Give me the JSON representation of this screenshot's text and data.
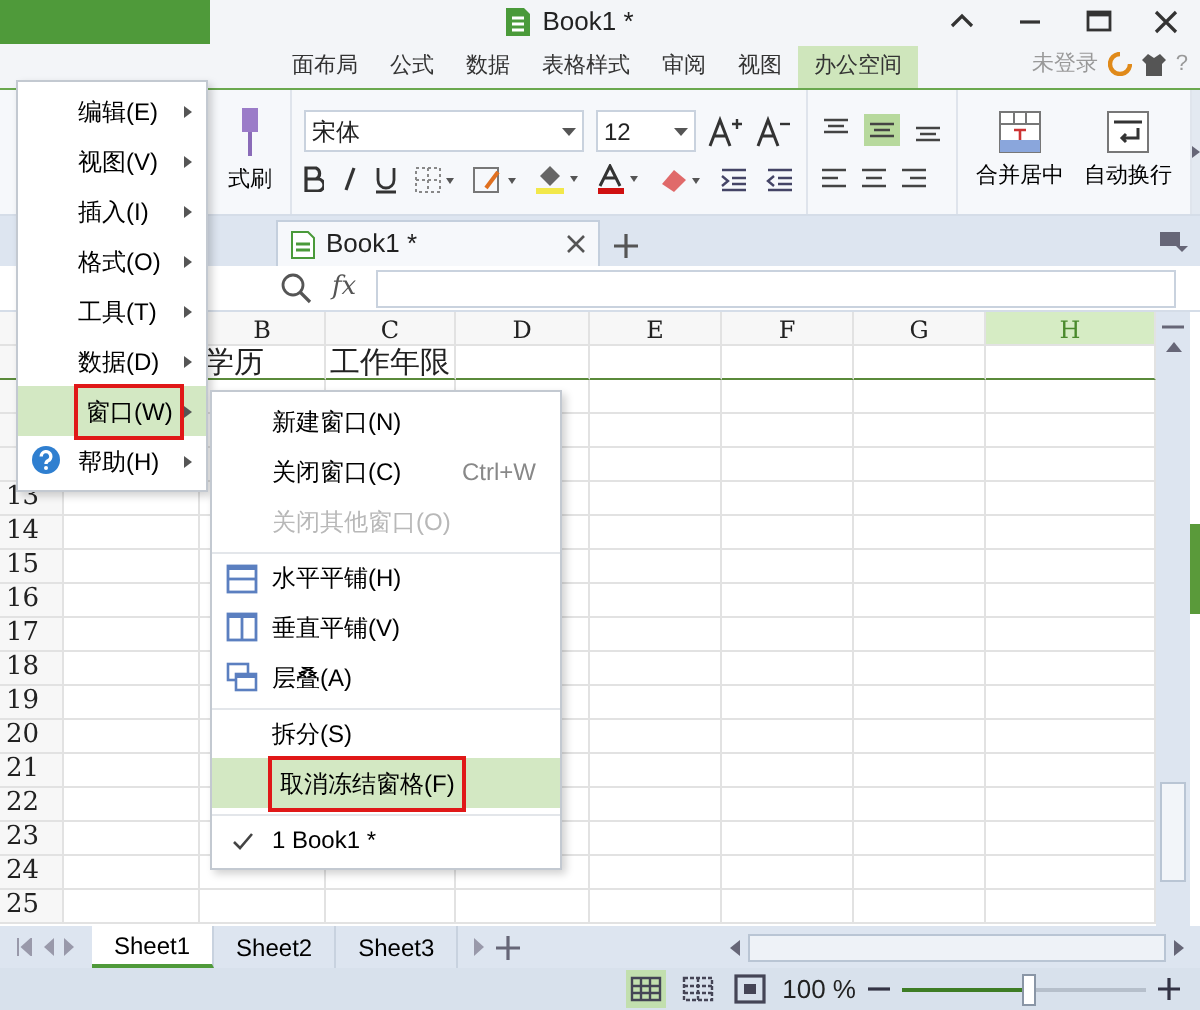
{
  "title_bar": {
    "title": "Book1 *"
  },
  "ribbon_tabs": [
    {
      "label": "面布局",
      "selected": false
    },
    {
      "label": "公式",
      "selected": false
    },
    {
      "label": "数据",
      "selected": false
    },
    {
      "label": "表格样式",
      "selected": false
    },
    {
      "label": "审阅",
      "selected": false
    },
    {
      "label": "视图",
      "selected": false
    },
    {
      "label": "办公空间",
      "selected": true
    }
  ],
  "account": {
    "label": "未登录",
    "help": "?"
  },
  "ribbon": {
    "format_painter": "式刷",
    "font": "宋体",
    "font_size": "12",
    "merge": "合并居中",
    "wrap": "自动换行"
  },
  "doc_tabs": [
    {
      "label": "Book1 *",
      "selected": true
    }
  ],
  "formula_bar": {
    "fx": "fx"
  },
  "columns": [
    {
      "label": "B",
      "selected": false
    },
    {
      "label": "C",
      "selected": false
    },
    {
      "label": "D",
      "selected": false
    },
    {
      "label": "E",
      "selected": false
    },
    {
      "label": "F",
      "selected": false
    },
    {
      "label": "G",
      "selected": false
    },
    {
      "label": "H",
      "selected": true
    }
  ],
  "header_row": {
    "cells": [
      "学历",
      "工作年限"
    ]
  },
  "row_numbers": [
    "13",
    "14",
    "15",
    "16",
    "17",
    "18",
    "19",
    "20",
    "21",
    "22",
    "23",
    "24",
    "25"
  ],
  "sheet_tabs": [
    {
      "label": "Sheet1",
      "selected": true
    },
    {
      "label": "Sheet2",
      "selected": false
    },
    {
      "label": "Sheet3",
      "selected": false
    }
  ],
  "status_bar": {
    "view_modes": [
      {
        "kind": "normal",
        "selected": true
      },
      {
        "kind": "page",
        "selected": false
      },
      {
        "kind": "reading",
        "selected": false
      }
    ],
    "zoom": "100 %",
    "zoom_slider": {
      "level": 0.52
    }
  },
  "main_menu": [
    {
      "label": "编辑(E)",
      "kind": "plain",
      "selected": false,
      "outlined": false
    },
    {
      "label": "视图(V)",
      "kind": "plain",
      "selected": false,
      "outlined": false
    },
    {
      "label": "插入(I)",
      "kind": "plain",
      "selected": false,
      "outlined": false
    },
    {
      "label": "格式(O)",
      "kind": "plain",
      "selected": false,
      "outlined": false
    },
    {
      "label": "工具(T)",
      "kind": "plain",
      "selected": false,
      "outlined": false
    },
    {
      "label": "数据(D)",
      "kind": "plain",
      "selected": false,
      "outlined": false
    },
    {
      "label": "窗口(W)",
      "kind": "plain",
      "selected": true,
      "outlined": true
    },
    {
      "label": "帮助(H)",
      "kind": "help",
      "selected": false,
      "outlined": false
    }
  ],
  "submenu": [
    {
      "label": "新建窗口(N)",
      "kind": "plain",
      "disabled": false,
      "selected": false,
      "outlined": false,
      "separator_before": false
    },
    {
      "label": "关闭窗口(C)",
      "shortcut": "Ctrl+W",
      "kind": "plain",
      "disabled": false,
      "selected": false,
      "outlined": false,
      "separator_before": false
    },
    {
      "label": "关闭其他窗口(O)",
      "kind": "plain",
      "disabled": true,
      "selected": false,
      "outlined": false,
      "separator_before": false
    },
    {
      "label": "水平平铺(H)",
      "kind": "horizontal",
      "disabled": false,
      "selected": false,
      "outlined": false,
      "separator_before": true
    },
    {
      "label": "垂直平铺(V)",
      "kind": "vertical",
      "disabled": false,
      "selected": false,
      "outlined": false,
      "separator_before": false
    },
    {
      "label": "层叠(A)",
      "kind": "cascade",
      "disabled": false,
      "selected": false,
      "outlined": false,
      "separator_before": false
    },
    {
      "label": "拆分(S)",
      "kind": "plain",
      "disabled": false,
      "selected": false,
      "outlined": false,
      "separator_before": true
    },
    {
      "label": "取消冻结窗格(F)",
      "kind": "plain",
      "disabled": false,
      "selected": true,
      "outlined": true,
      "separator_before": false
    },
    {
      "label": "1 Book1 *",
      "kind": "check",
      "disabled": false,
      "selected": false,
      "outlined": false,
      "separator_before": true
    }
  ]
}
